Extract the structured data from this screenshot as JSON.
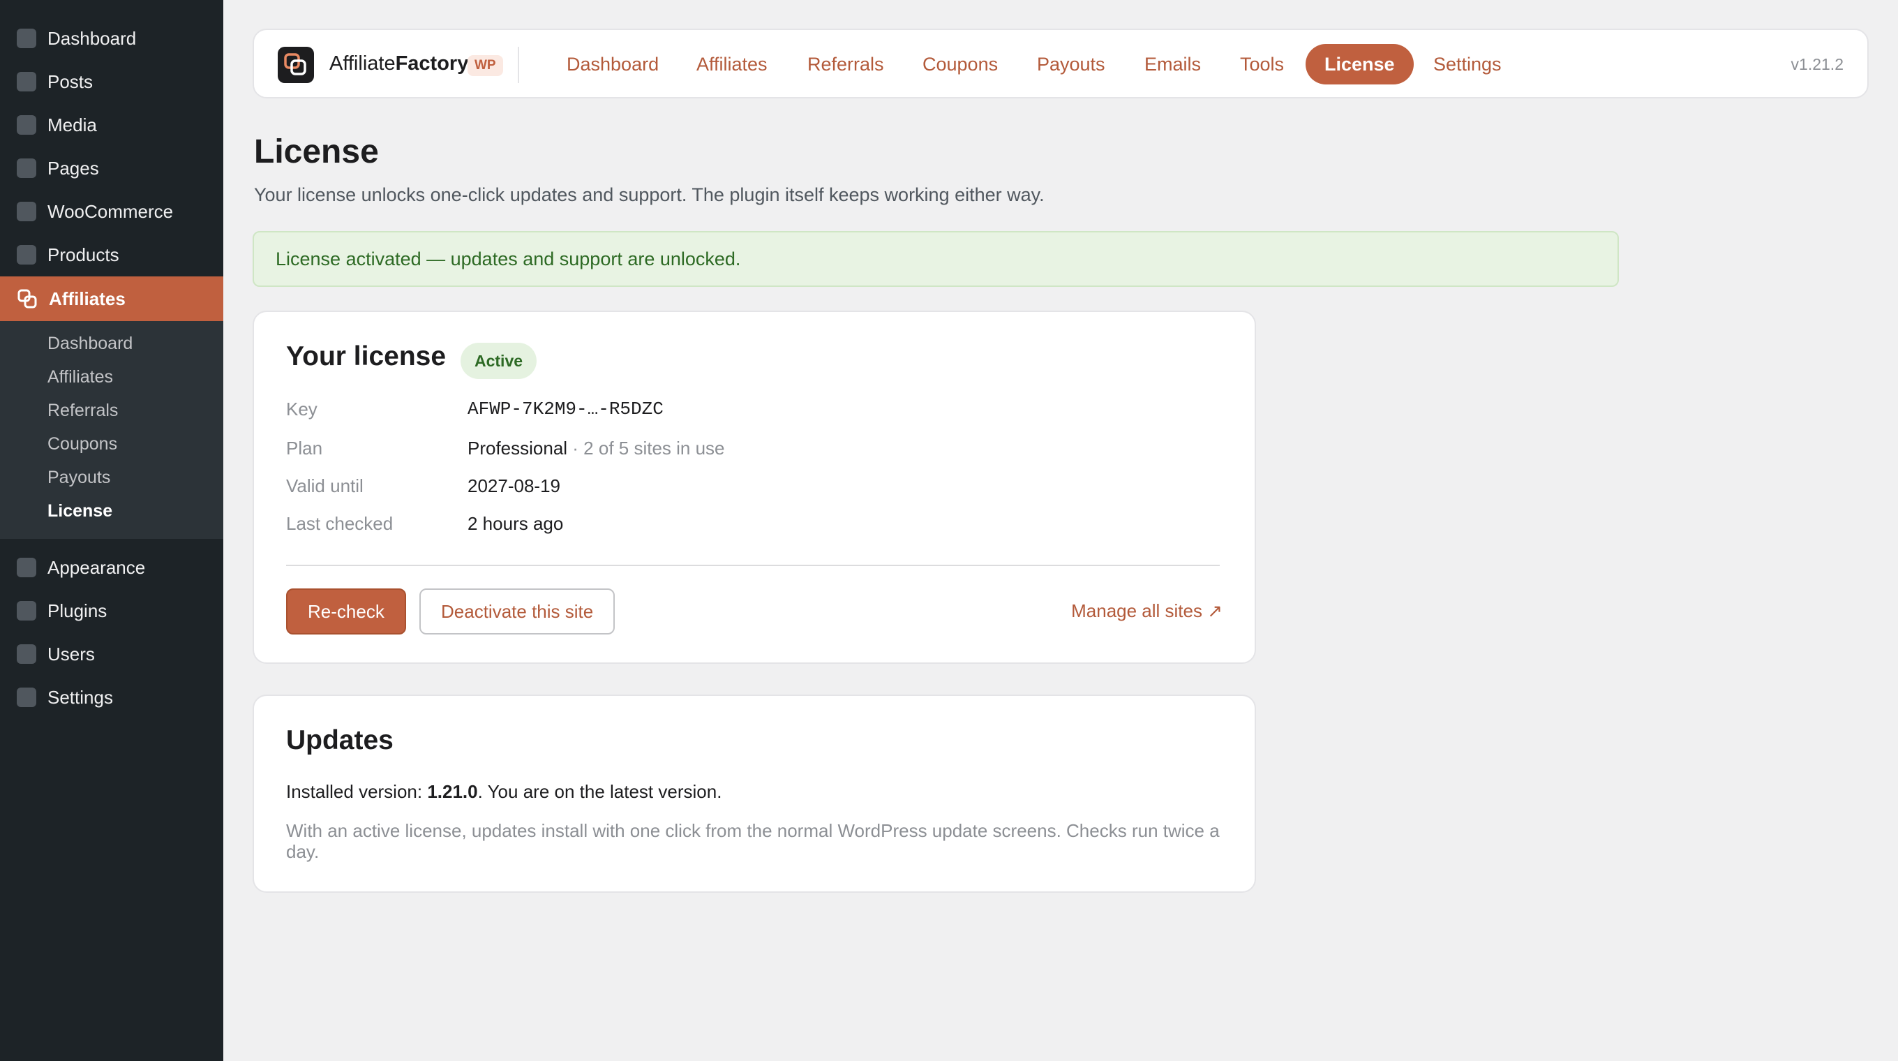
{
  "sidebar": {
    "items_top": [
      {
        "label": "Dashboard"
      },
      {
        "label": "Posts"
      },
      {
        "label": "Media"
      },
      {
        "label": "Pages"
      },
      {
        "label": "WooCommerce"
      },
      {
        "label": "Products"
      }
    ],
    "active": {
      "label": "Affiliates",
      "icon": "affiliate-icon"
    },
    "submenu": [
      {
        "label": "Dashboard"
      },
      {
        "label": "Affiliates"
      },
      {
        "label": "Referrals"
      },
      {
        "label": "Coupons"
      },
      {
        "label": "Payouts"
      },
      {
        "label": "License",
        "active": true
      }
    ],
    "items_bottom": [
      {
        "label": "Appearance"
      },
      {
        "label": "Plugins"
      },
      {
        "label": "Users"
      },
      {
        "label": "Settings"
      }
    ]
  },
  "topnav": {
    "brand_prefix": "Affiliate",
    "brand_suffix": "Factory",
    "badge": "WP",
    "tabs": [
      {
        "label": "Dashboard"
      },
      {
        "label": "Affiliates"
      },
      {
        "label": "Referrals"
      },
      {
        "label": "Coupons"
      },
      {
        "label": "Payouts"
      },
      {
        "label": "Emails"
      },
      {
        "label": "Tools"
      },
      {
        "label": "License",
        "active": true
      },
      {
        "label": "Settings"
      }
    ],
    "version": "v1.21.2"
  },
  "page": {
    "title": "License",
    "subtitle": "Your license unlocks one-click updates and support. The plugin itself keeps working either way."
  },
  "notice": {
    "text": "License activated — updates and support are unlocked."
  },
  "license_card": {
    "title": "Your license",
    "status": "Active",
    "rows": [
      {
        "label": "Key",
        "value": "AFWP-7K2M9-…-R5DZC"
      },
      {
        "label": "Plan",
        "value": "Professional",
        "extra": " · 2 of 5 sites in use"
      },
      {
        "label": "Valid until",
        "value": "2027-08-19"
      },
      {
        "label": "Last checked",
        "value": "2 hours ago"
      }
    ],
    "recheck_label": "Re-check",
    "deactivate_label": "Deactivate this site",
    "manage_label": "Manage all sites ↗"
  },
  "updates_card": {
    "title": "Updates",
    "installed_prefix": "Installed version: ",
    "installed_version": "1.21.0",
    "installed_suffix": ". You are on the latest version.",
    "note": "With an active license, updates install with one click from the normal WordPress update screens. Checks run twice a day."
  },
  "colors": {
    "accent": "#c0603f",
    "sidebar_bg": "#1d2327",
    "success_bg": "#e8f3e3",
    "success_text": "#2d6a24"
  }
}
